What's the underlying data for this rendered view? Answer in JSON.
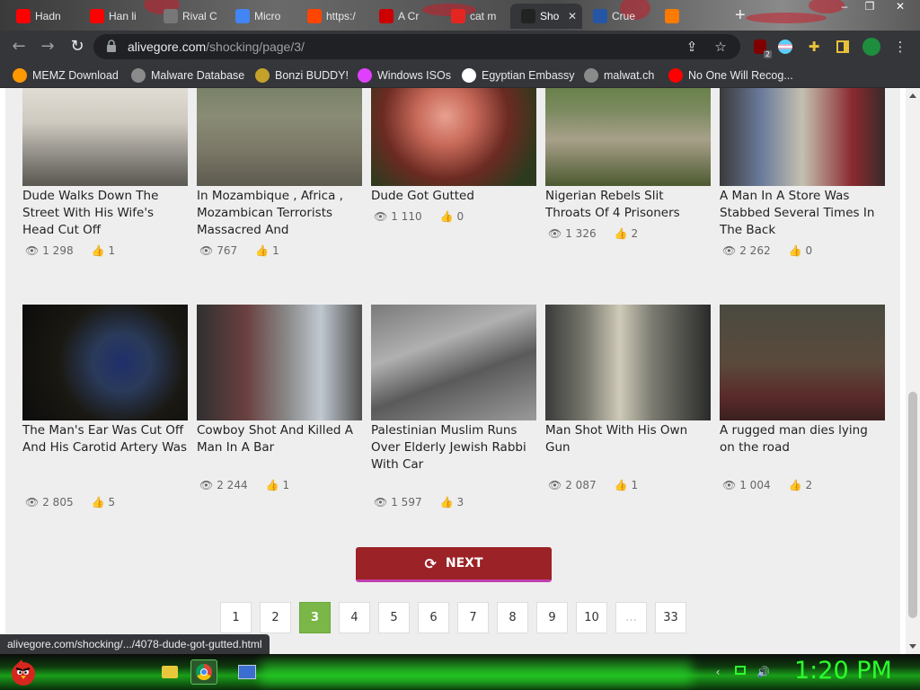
{
  "browser": {
    "tabs": [
      {
        "label": "Hadn",
        "favicon_color": "#ff0000"
      },
      {
        "label": "Han li",
        "favicon_color": "#ff0000"
      },
      {
        "label": "Rival C",
        "favicon_color": "#777777"
      },
      {
        "label": "Micro",
        "favicon_color": "#4285f4"
      },
      {
        "label": "https:/",
        "favicon_color": "#ff4500"
      },
      {
        "label": "A Cr",
        "favicon_color": "#cc0000"
      },
      {
        "label": "cat m",
        "favicon_color": "#e52620"
      },
      {
        "label": "Sho",
        "favicon_color": "#222222"
      },
      {
        "label": "Crue",
        "favicon_color": "#2456a5"
      },
      {
        "label": "",
        "favicon_color": "#ff7a00"
      }
    ],
    "new_tab": "+",
    "url_host": "alivegore.com",
    "url_path": "/shocking/page/3/",
    "extension_badge": "2"
  },
  "bookmarks": [
    {
      "label": "MEMZ Download",
      "icon_color": "#ff9900"
    },
    {
      "label": "Malware Database",
      "icon_color": "#8a8a8a"
    },
    {
      "label": "Bonzi BUDDY!",
      "icon_color": "#c4a22a"
    },
    {
      "label": "Windows ISOs",
      "icon_color": "#e040fb"
    },
    {
      "label": "Egyptian Embassy",
      "icon_color": "#ffffff"
    },
    {
      "label": "malwat.ch",
      "icon_color": "#8a8a8a"
    },
    {
      "label": "No One Will Recog...",
      "icon_color": "#ff0000"
    }
  ],
  "cards": [
    {
      "title": "Dude Walks Down The Street With His Wife's Head Cut Off",
      "views": "1 298",
      "likes": "1"
    },
    {
      "title": "In Mozambique , Africa , Mozambican Terrorists Massacred And",
      "views": "767",
      "likes": "1"
    },
    {
      "title": "Dude Got Gutted",
      "views": "1 110",
      "likes": "0"
    },
    {
      "title": "Nigerian Rebels Slit Throats Of 4 Prisoners",
      "views": "1 326",
      "likes": "2"
    },
    {
      "title": "A Man In A Store Was Stabbed Several Times In The Back",
      "views": "2 262",
      "likes": "0"
    },
    {
      "title": "The Man's Ear Was Cut Off And His Carotid Artery Was",
      "views": "2 805",
      "likes": "5"
    },
    {
      "title": "Cowboy Shot And Killed A Man In A Bar",
      "views": "2 244",
      "likes": "1"
    },
    {
      "title": "Palestinian Muslim Runs Over Elderly Jewish Rabbi With Car",
      "views": "1 597",
      "likes": "3"
    },
    {
      "title": "Man Shot With His Own Gun",
      "views": "2 087",
      "likes": "1"
    },
    {
      "title": "A rugged man dies lying on the road",
      "views": "1 004",
      "likes": "2"
    }
  ],
  "next_label": "NEXT",
  "pagination": [
    "1",
    "2",
    "3",
    "4",
    "5",
    "6",
    "7",
    "8",
    "9",
    "10",
    "...",
    "33"
  ],
  "active_page": "3",
  "status_url": "alivegore.com/shocking/.../4078-dude-got-gutted.html",
  "taskbar": {
    "clock": "1:20 PM"
  }
}
